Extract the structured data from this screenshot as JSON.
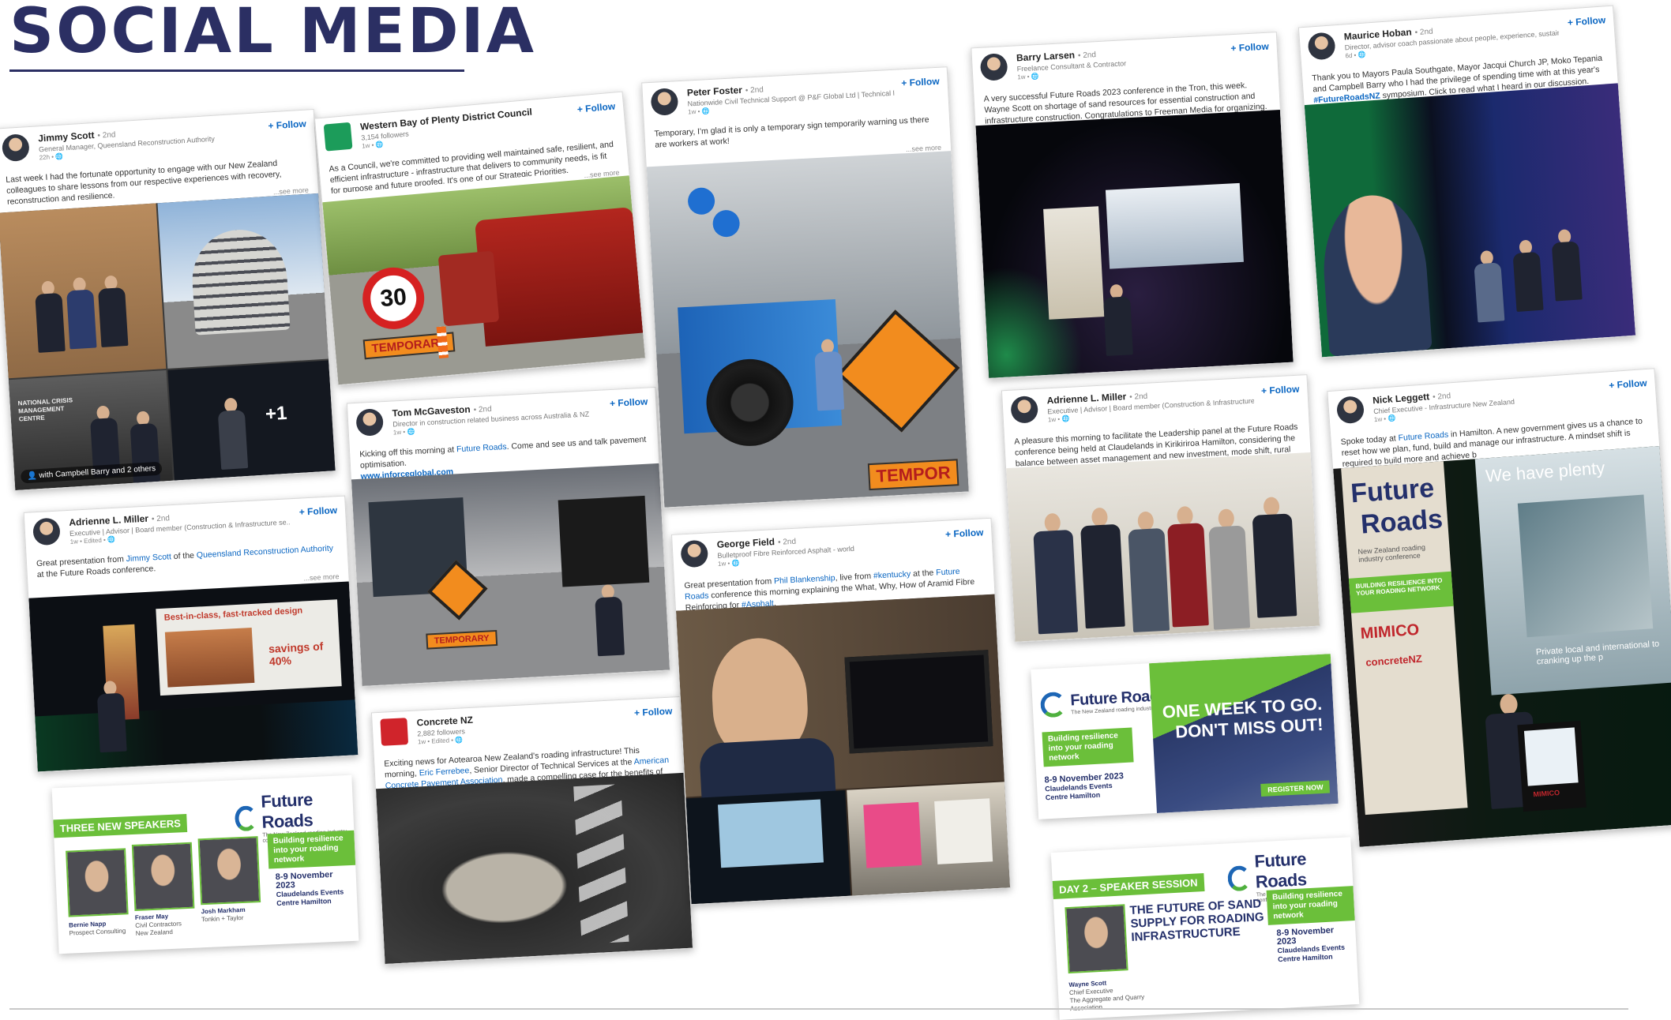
{
  "page": {
    "title": "SOCIAL MEDIA"
  },
  "labels": {
    "follow": "+ Follow",
    "see_more": "...see more"
  },
  "posts": [
    {
      "author": "Jimmy Scott",
      "degree": "• 2nd",
      "headline": "General Manager, Queensland Reconstruction Authority",
      "meta": "22h • ",
      "text": "Last week I had the fortunate opportunity to engage with our New Zealand colleagues to share lessons from our respective experiences with recovery, reconstruction and resilience.",
      "tagged": "with Campbell Barry and 2 others",
      "more_photos": "+1",
      "sign_text": "NATIONAL CRISIS MANAGEMENT CENTRE"
    },
    {
      "author": "Western Bay of Plenty District Council",
      "degree": "",
      "headline": "3,154 followers",
      "meta": "1w • ",
      "text": "As a Council, we're committed to providing well maintained safe, resilient, and efficient infrastructure - infrastructure that delivers to community needs, is fit for purpose and future proofed. It's one of our Strategic Priorities.",
      "speed": "30",
      "board": "TEMPORARY"
    },
    {
      "author": "Peter Foster",
      "degree": "• 2nd",
      "headline": "Nationwide Civil Technical Support @ P&F Global Ltd | Technical Fi...",
      "meta": "1w • ",
      "text": "Temporary, I'm glad it is only a temporary sign temporarily warning us there are workers at work!",
      "board": "TEMPOR"
    },
    {
      "author": "Barry Larsen",
      "degree": "• 2nd",
      "headline": "Freelance Consultant & Contractor",
      "meta": "1w • ",
      "text": "A very successful Future Roads 2023 conference in the Tron, this week. Wayne Scott on shortage of sand resources for essential construction and infrastructure construction. Congratulations to Freeman Media for organizing."
    },
    {
      "author": "Maurice Hoban",
      "degree": "• 2nd",
      "headline": "Director, advisor coach passionate about people, experience, sustain...",
      "meta": "6d • ",
      "text_pre": "Thank you to Mayors Paula Southgate, Mayor Jacqui Church JP, Moko Tepania and Campbell Barry who I had the privilege of spending time with at this year's ",
      "hashtag": "#FutureRoadsNZ",
      "text_post": " symposium. Click to read what I heard in our discussion."
    },
    {
      "author": "Adrienne L. Miller",
      "degree": "• 2nd",
      "headline": "Executive | Advisor | Board member (Construction & Infrastructure se...",
      "meta": "1w • Edited • ",
      "text_pre": "Great presentation from ",
      "link1": "Jimmy Scott",
      "text_mid": " of the ",
      "link2": "Queensland Reconstruction Authority",
      "text_post": " at the Future Roads conference.",
      "slide_title": "Best-in-class, fast-tracked design",
      "slide_stat": "savings of 40%"
    },
    {
      "author": "Tom McGaveston",
      "degree": "• 2nd",
      "headline": "Director in construction related business across Australia & NZ",
      "meta": "1w • ",
      "text_pre": "Kicking off this morning at ",
      "link1": "Future Roads",
      "text_post": ". Come and see us and talk pavement optimisation.",
      "url": "www.inforceglobal.com",
      "board": "TEMPORARY"
    },
    {
      "author": "George Field",
      "degree": "• 2nd",
      "headline": "Bulletproof Fibre Reinforced Asphalt - world",
      "meta": "1w • ",
      "text_pre": "Great presentation from ",
      "link1": "Phil Blankenship",
      "text_mid": ", live from ",
      "link2": "#kentucky",
      "text_mid2": " at the ",
      "link3": "Future Roads",
      "text_post": " conference this morning explaining the What, Why, How of Aramid Fibre Reinforcing for ",
      "link4": "#Asphalt",
      "text_end": "."
    },
    {
      "author": "Adrienne L. Miller",
      "degree": "• 2nd",
      "headline": "Executive | Advisor | Board member (Construction & Infrastructure se...",
      "meta": "1w • ",
      "text": "A pleasure this morning to facilitate the Leadership panel at the Future Roads conference being held at Claudelands in Kirikiriroa Hamilton, considering the balance between asset management and new investment, mode shift, rural versus"
    },
    {
      "author": "Nick Leggett",
      "degree": "• 2nd",
      "headline": "Chief Executive - Infrastructure New Zealand",
      "meta": "1w • ",
      "text_pre": "Spoke today at ",
      "link1": "Future Roads",
      "text_post": " in Hamilton. A new government gives us a chance to reset how we plan, fund, build and manage our infrastructure. A mindset shift is required to build more and achieve b",
      "banner1": "Future",
      "banner2": "Roads",
      "banner3": "New Zealand roading industry conference",
      "banner4": "BUILDING RESILIENCE INTO YOUR ROADING NETWORK",
      "sponsor1": "MIMICO",
      "sponsor2": "concreteNZ",
      "screen_head": "We have plenty",
      "screen_foot": "Private local and international to cranking up the p",
      "lectern": "MIMICO"
    },
    {
      "author": "Concrete NZ",
      "degree": "",
      "headline": "2,882 followers",
      "meta": "1w • Edited • ",
      "text_pre": "Exciting news for Aotearoa New Zealand's roading infrastructure! This morning, ",
      "link1": "Eric Ferrebee",
      "text_mid": ", Senior Director of Technical Services at the ",
      "link2": "American Concrete Pavement Association",
      "text_post": ", made a compelling case for the benefits of concrete road par"
    }
  ],
  "flyers": {
    "brand": "Future Roads",
    "brand_tag": "The New Zealand roading industry conference",
    "resilience": "Building resilience into your roading network",
    "date": "8-9 November 2023",
    "venue": "Claudelands Events Centre Hamilton",
    "speakers": {
      "tag": "THREE NEW SPEAKERS",
      "people": [
        {
          "name": "Bernie Napp",
          "org": "Prospect Consulting"
        },
        {
          "name": "Fraser May",
          "org": "Civil Contractors New Zealand"
        },
        {
          "name": "Josh Markham",
          "org": "Tonkin + Taylor"
        }
      ]
    },
    "week": {
      "line1": "ONE WEEK TO GO.",
      "line2": "DON'T MISS OUT!",
      "cta": "REGISTER NOW"
    },
    "session": {
      "tag": "DAY 2 – SPEAKER SESSION",
      "headline": "THE FUTURE OF SAND SUPPLY FOR ROADING INFRASTRUCTURE",
      "speaker": "Wayne Scott",
      "role": "Chief Executive",
      "org": "The Aggregate and Quarry Association"
    }
  },
  "colors": {
    "title": "#2b2f63",
    "link": "#0a66c2",
    "green": "#6bbf3a",
    "navy": "#24306b"
  }
}
